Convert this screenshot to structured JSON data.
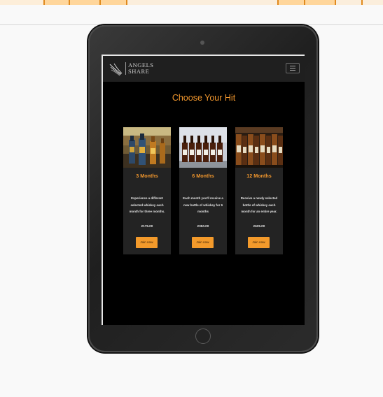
{
  "site": {
    "logo": {
      "line1": "ANGELS",
      "line2": "SHARE"
    },
    "menu_icon": "hamburger-menu-icon"
  },
  "section": {
    "title": "Choose Your Hit"
  },
  "cards": [
    {
      "title": "3 Months",
      "description": "Experience a different selected whiskey each month for three months.",
      "price": "€175.00",
      "button": "Join now",
      "image": "whiskey-bottles-photo"
    },
    {
      "title": "6 Months",
      "description": "Each month you'll receive a new bottle of whiskey for 6 months",
      "price": "€350.00",
      "button": "Join now",
      "image": "whiskey-bottles-row-photo"
    },
    {
      "title": "12 Months",
      "description": "Receive a newly selected bottle of whiskey each month for an entire year.",
      "price": "€625.00",
      "button": "Join now",
      "image": "whiskey-shelf-photo"
    }
  ],
  "colors": {
    "accent": "#f0962d",
    "button": "#f39a2b",
    "card_bg": "#232323",
    "navbar_bg": "#1f1f1f",
    "page_bg": "#000000"
  }
}
